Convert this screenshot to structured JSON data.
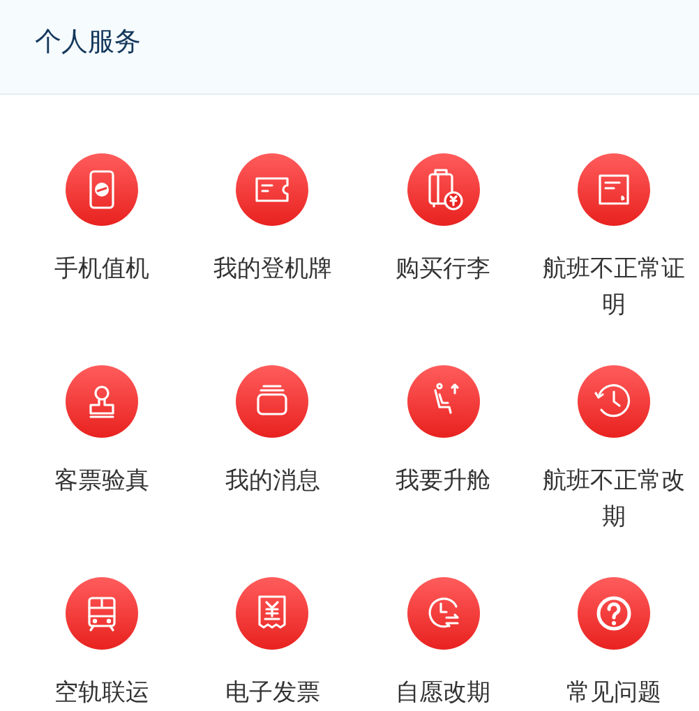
{
  "header": {
    "title": "个人服务"
  },
  "services": [
    {
      "label": "手机值机"
    },
    {
      "label": "我的登机牌"
    },
    {
      "label": "购买行李"
    },
    {
      "label": "航班不正常证明"
    },
    {
      "label": "客票验真"
    },
    {
      "label": "我的消息"
    },
    {
      "label": "我要升舱"
    },
    {
      "label": "航班不正常改期"
    },
    {
      "label": "空轨联运"
    },
    {
      "label": "电子发票"
    },
    {
      "label": "自愿改期"
    },
    {
      "label": "常见问题"
    }
  ]
}
